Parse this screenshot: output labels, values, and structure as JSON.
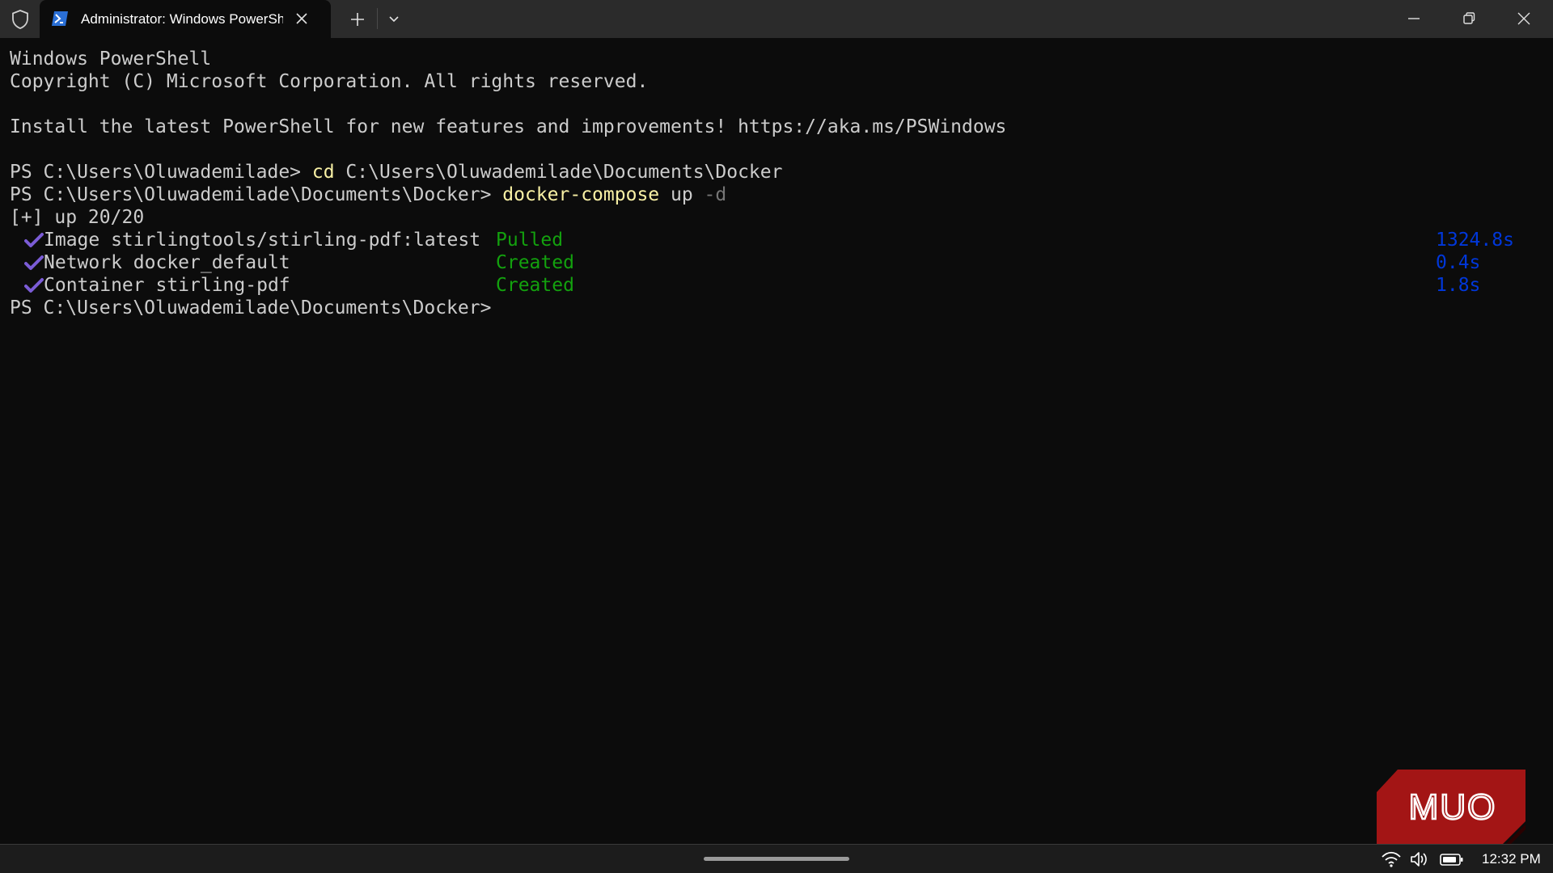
{
  "window": {
    "tab_title": "Administrator: Windows PowerShell"
  },
  "terminal": {
    "banner_line1": "Windows PowerShell",
    "banner_line2": "Copyright (C) Microsoft Corporation. All rights reserved.",
    "install_line": "Install the latest PowerShell for new features and improvements! https://aka.ms/PSWindows",
    "prompt1": "PS C:\\Users\\Oluwademilade> ",
    "cmd1_keyword": "cd",
    "cmd1_args": " C:\\Users\\Oluwademilade\\Documents\\Docker",
    "prompt2": "PS C:\\Users\\Oluwademilade\\Documents\\Docker> ",
    "cmd2_keyword": "docker-compose",
    "cmd2_arg1": " up ",
    "cmd2_flag": "-d",
    "progress": "[+] up 20/20",
    "services": [
      {
        "name": "Image stirlingtools/stirling-pdf:latest",
        "status": "Pulled",
        "time": "1324.8s"
      },
      {
        "name": "Network docker_default",
        "status": "Created",
        "time": "0.4s"
      },
      {
        "name": "Container stirling-pdf",
        "status": "Created",
        "time": "1.8s"
      }
    ],
    "prompt3": "PS C:\\Users\\Oluwademilade\\Documents\\Docker>"
  },
  "watermark": {
    "text": "MUO"
  },
  "taskbar": {
    "time": "12:32 PM"
  },
  "colors": {
    "terminal_bg": "#0c0c0c",
    "titlebar_bg": "#2b2b2b",
    "text": "#cccccc",
    "command_yellow": "#f9f1a5",
    "flag_grey": "#767676",
    "status_green": "#13a10e",
    "time_blue": "#0037da",
    "check_purple": "#7b5cd6",
    "watermark_red": "#a31515"
  },
  "icons": [
    "shield-icon",
    "powershell-icon",
    "close-tab-icon",
    "plus-icon",
    "chevron-down-icon",
    "minimize-icon",
    "restore-icon",
    "close-icon",
    "checkmark-icon",
    "wifi-icon",
    "volume-icon",
    "battery-icon"
  ]
}
